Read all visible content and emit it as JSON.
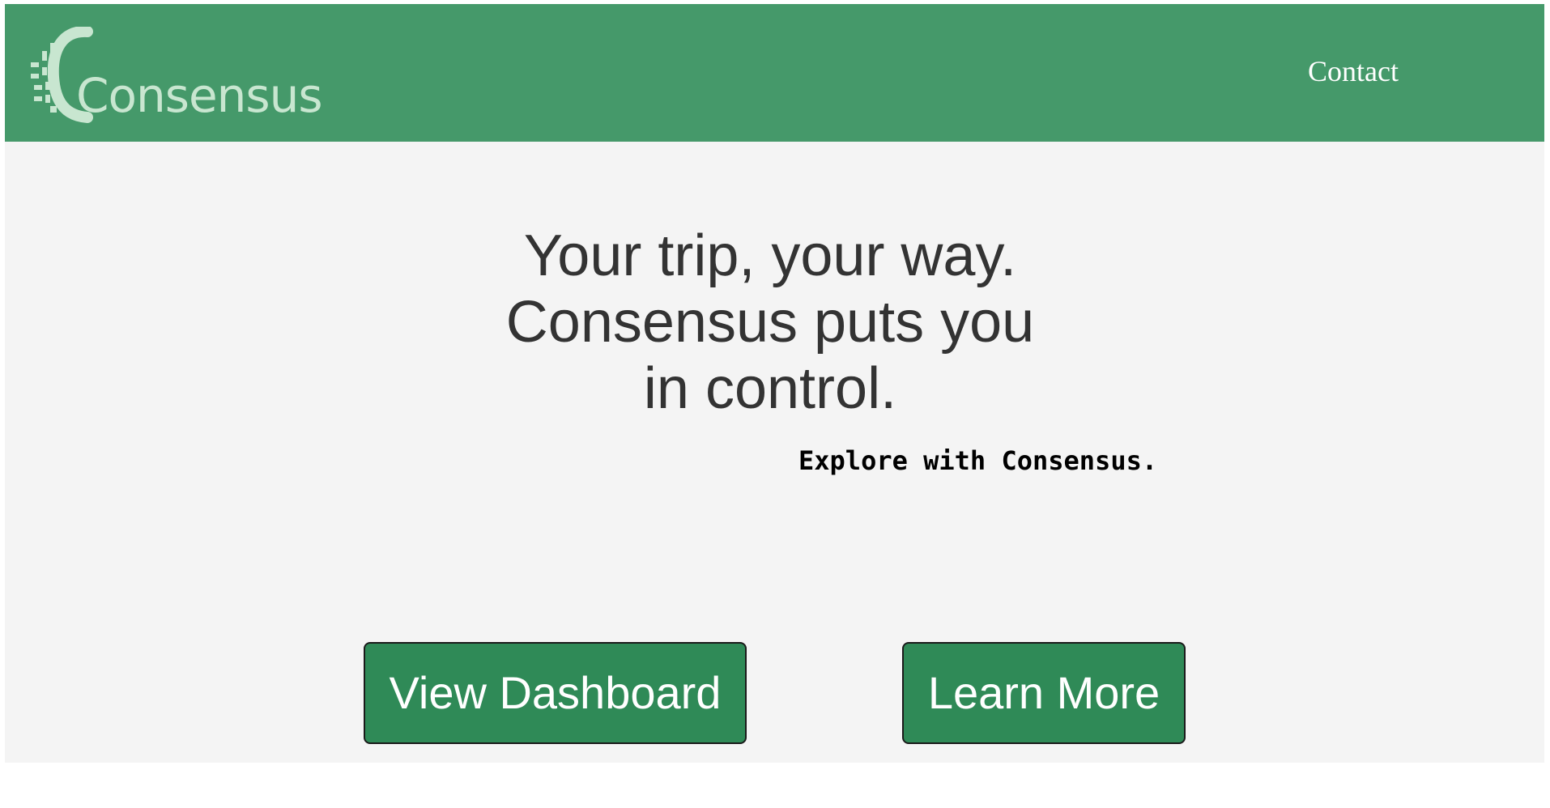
{
  "header": {
    "logo_text": "Consensus",
    "nav": {
      "contact_label": "Contact"
    }
  },
  "hero": {
    "headline_line1": "Your trip, your way.",
    "headline_line2": "Consensus puts you",
    "headline_line3": "in control.",
    "tagline": "Explore with Consensus.",
    "buttons": {
      "view_dashboard_label": "View Dashboard",
      "learn_more_label": "Learn More"
    }
  },
  "colors": {
    "header_bg": "#45996a",
    "hero_bg": "#f4f4f4",
    "button_bg": "#2f8a57",
    "headline_text": "#333333",
    "logo_text": "#c8e6d0"
  },
  "icons": {
    "logo_mark": "consensus-logo-icon"
  }
}
